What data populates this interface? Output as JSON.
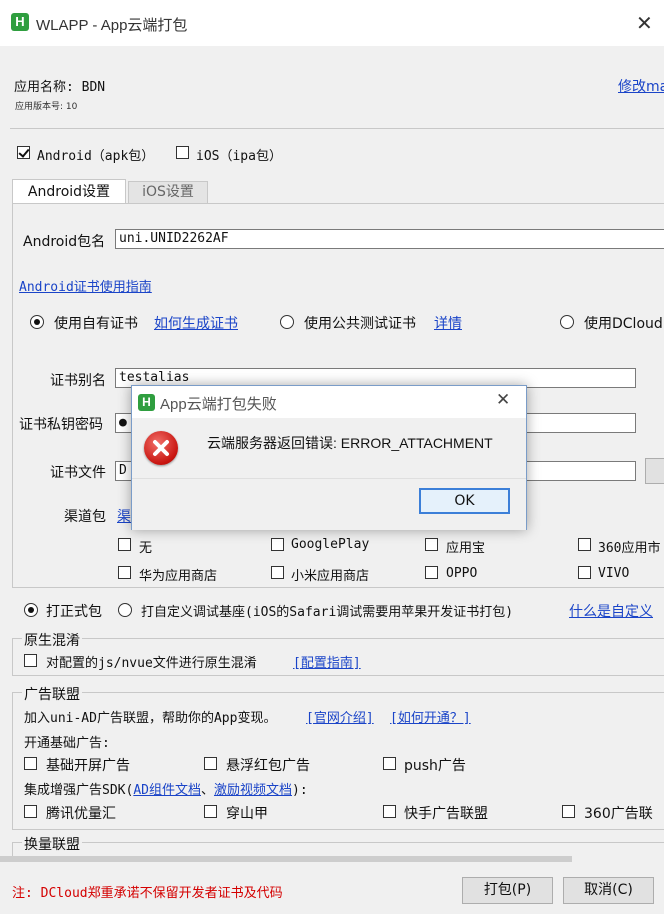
{
  "window": {
    "title": "WLAPP - App云端打包",
    "close": "✕"
  },
  "app": {
    "name_line": "应用名称: BDN",
    "version_line": "应用版本号: 10",
    "modify_link": "修改ma"
  },
  "platforms": {
    "android_label": "Android（apk包）",
    "android_checked": true,
    "ios_label": "iOS（ipa包）",
    "ios_checked": false
  },
  "tabs": [
    {
      "label": "Android设置",
      "active": true
    },
    {
      "label": "iOS设置",
      "active": false
    }
  ],
  "android": {
    "package_label": "Android包名",
    "package_value": "uni.UNID2262AF",
    "cert_guide_link": "Android证书使用指南",
    "cert_options": [
      {
        "label": "使用自有证书",
        "checked": true,
        "link": "如何生成证书"
      },
      {
        "label": "使用公共测试证书",
        "checked": false,
        "link": "详情"
      },
      {
        "label": "使用DCloud",
        "checked": false
      }
    ],
    "alias_label": "证书别名",
    "alias_value": "testalias",
    "password_label": "证书私钥密码",
    "password_value": "●",
    "file_label": "证书文件",
    "file_value": "D",
    "channel_label": "渠道包",
    "channel_link": "渠",
    "channels": [
      {
        "label": "无",
        "checked": false
      },
      {
        "label": "GooglePlay",
        "checked": false
      },
      {
        "label": "应用宝",
        "checked": false
      },
      {
        "label": "360应用市",
        "checked": false
      },
      {
        "label": "华为应用商店",
        "checked": false
      },
      {
        "label": "小米应用商店",
        "checked": false
      },
      {
        "label": "OPPO",
        "checked": false
      },
      {
        "label": "VIVO",
        "checked": false
      }
    ]
  },
  "build_type": {
    "release_label": "打正式包",
    "release_checked": true,
    "debug_label": "打自定义调试基座(iOS的Safari调试需要用苹果开发证书打包)",
    "debug_checked": false,
    "whatis_link": "什么是自定义"
  },
  "obfuscate": {
    "title": "原生混淆",
    "checkbox_label": "对配置的js/nvue文件进行原生混淆",
    "guide_link": "[配置指南]"
  },
  "ads": {
    "title": "广告联盟",
    "intro": "加入uni-AD广告联盟，帮助你的App变现。",
    "intro_link1": "[官网介绍]",
    "intro_link2": "[如何开通？]",
    "basic_title": "开通基础广告:",
    "basic": [
      {
        "label": "基础开屏广告"
      },
      {
        "label": "悬浮红包广告"
      },
      {
        "label": "push广告"
      }
    ],
    "sdk_prefix": "集成增强广告SDK(",
    "sdk_link1": "AD组件文档",
    "sdk_sep": "、",
    "sdk_link2": "激励视频文档",
    "sdk_suffix": "):",
    "sdk": [
      {
        "label": "腾讯优量汇"
      },
      {
        "label": "穿山甲"
      },
      {
        "label": "快手广告联盟"
      },
      {
        "label": "360广告联"
      }
    ]
  },
  "exchange": {
    "title": "换量联盟"
  },
  "footer": {
    "note": "注: DCloud郑重承诺不保留开发者证书及代码",
    "note_color": "#d40000",
    "pack_button": "打包(P)",
    "cancel_button": "取消(C)"
  },
  "dialog": {
    "title": "App云端打包失败",
    "message": "云端服务器返回错误: ERROR_ATTACHMENT",
    "ok": "OK",
    "close": "✕",
    "icon": "error-icon"
  }
}
